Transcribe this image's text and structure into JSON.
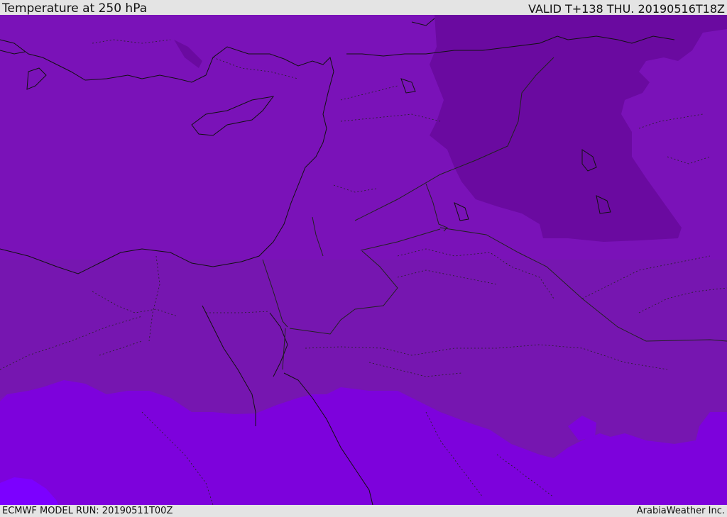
{
  "header": {
    "title": "Temperature at 250 hPa",
    "valid_time": "VALID T+138 THU. 20190516T18Z"
  },
  "footer": {
    "model_run": "ECMWF MODEL RUN: 20190511T00Z",
    "credit": "ArabiaWeather Inc."
  },
  "colors": {
    "background_band": "#7a12b8",
    "cold_band": "#6a0aa0",
    "mid_band": "#7616b0",
    "warm_band": "#7d02dc",
    "warmest_band": "#7c00ff",
    "coastline": "#111111",
    "border": "#222222"
  }
}
